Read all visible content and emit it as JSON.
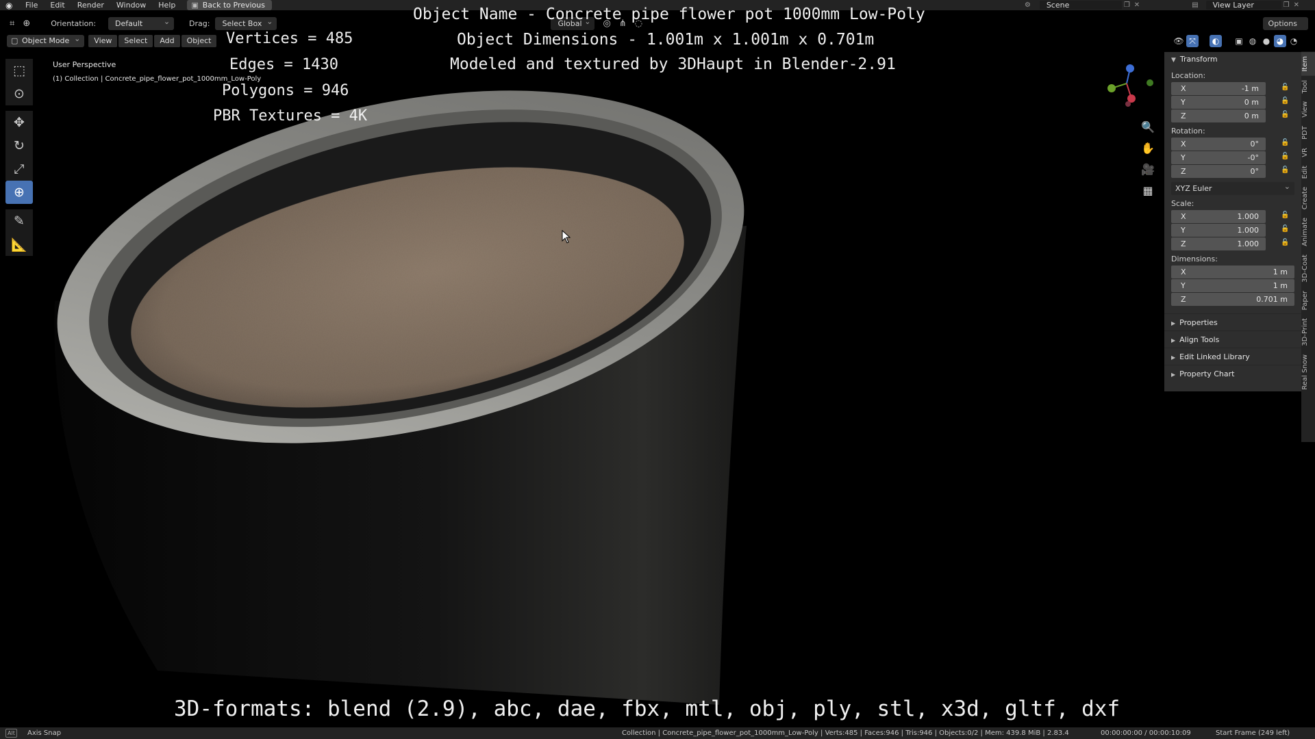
{
  "menubar": {
    "items": [
      "File",
      "Edit",
      "Render",
      "Window",
      "Help"
    ],
    "back_button": "Back to Previous",
    "scene": "Scene",
    "view_layer": "View Layer"
  },
  "toolbar": {
    "orientation_label": "Orientation:",
    "orientation_value": "Default",
    "drag_label": "Drag:",
    "drag_value": "Select Box",
    "transform_orientation": "Global",
    "options": "Options"
  },
  "viewport_header": {
    "mode": "Object Mode",
    "tabs": [
      "View",
      "Select",
      "Add",
      "Object"
    ]
  },
  "viewport_info": {
    "perspective": "User Perspective",
    "collection": "(1) Collection | Concrete_pipe_flower_pot_1000mm_Low-Poly"
  },
  "overlay": {
    "vertices": "Vertices = 485",
    "edges": "Edges = 1430",
    "polygons": "Polygons = 946",
    "pbr": "PBR Textures = 4K",
    "object_name": "Object Name - Concrete pipe flower pot 1000mm Low-Poly",
    "object_dimensions": "Object Dimensions -  1.001m x 1.001m x 0.701m",
    "modeled_by": "Modeled and textured by 3DHaupt in Blender-2.91",
    "formats": "3D-formats: blend (2.9), abc, dae, fbx, mtl, obj, ply, stl, x3d, gltf, dxf"
  },
  "npanel": {
    "transform_title": "Transform",
    "location_label": "Location:",
    "location": [
      {
        "axis": "X",
        "value": "-1 m"
      },
      {
        "axis": "Y",
        "value": "0 m"
      },
      {
        "axis": "Z",
        "value": "0 m"
      }
    ],
    "rotation_label": "Rotation:",
    "rotation": [
      {
        "axis": "X",
        "value": "0°"
      },
      {
        "axis": "Y",
        "value": "-0°"
      },
      {
        "axis": "Z",
        "value": "0°"
      }
    ],
    "rotation_mode": "XYZ Euler",
    "scale_label": "Scale:",
    "scale": [
      {
        "axis": "X",
        "value": "1.000"
      },
      {
        "axis": "Y",
        "value": "1.000"
      },
      {
        "axis": "Z",
        "value": "1.000"
      }
    ],
    "dimensions_label": "Dimensions:",
    "dimensions": [
      {
        "axis": "X",
        "value": "1 m"
      },
      {
        "axis": "Y",
        "value": "1 m"
      },
      {
        "axis": "Z",
        "value": "0.701 m"
      }
    ],
    "subpanels": [
      "Properties",
      "Align Tools",
      "Edit Linked Library",
      "Property Chart"
    ]
  },
  "vertical_tabs": [
    "Item",
    "Tool",
    "View",
    "PDT",
    "VR",
    "Edit",
    "Create",
    "Animate",
    "3D-Coat",
    "Paper",
    "3D-Print",
    "Real Snow"
  ],
  "statusbar": {
    "alt_key": "Alt",
    "axis_snap": "Axis Snap",
    "info": "Collection | Concrete_pipe_flower_pot_1000mm_Low-Poly | Verts:485 | Faces:946 | Tris:946 | Objects:0/2 | Mem: 439.8 MiB | 2.83.4",
    "time": "00:00:00:00 / 00:00:10:09",
    "start_frame": "Start Frame (249 left)"
  },
  "colors": {
    "accent": "#4772b3",
    "panel": "#2e2e2e",
    "header": "#232323",
    "soil": "#8a7868",
    "concrete": "#9a9a96"
  }
}
